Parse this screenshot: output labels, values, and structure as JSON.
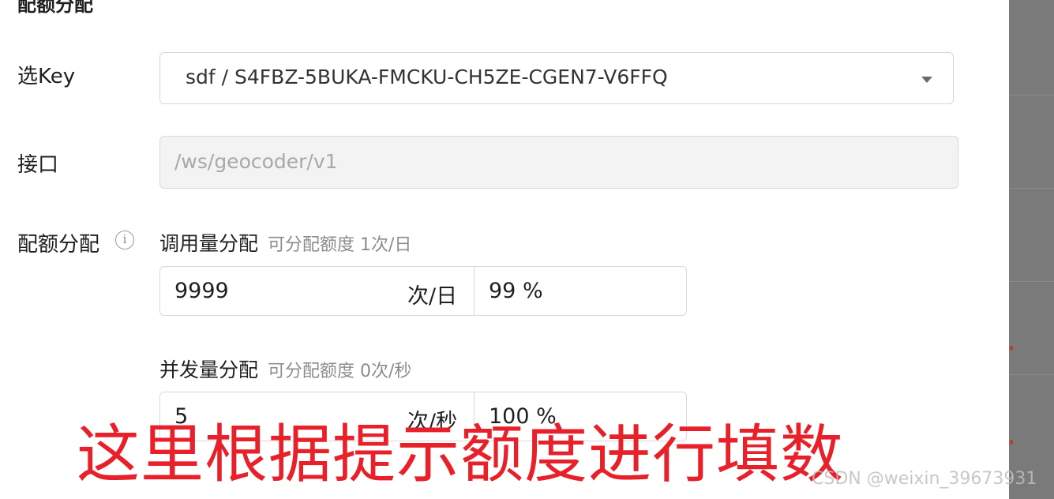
{
  "section": {
    "title": "配额分配"
  },
  "key_field": {
    "label": "选Key",
    "value": "sdf / S4FBZ-5BUKA-FMCKU-CH5ZE-CGEN7-V6FFQ"
  },
  "api_field": {
    "label": "接口",
    "placeholder": "/ws/geocoder/v1"
  },
  "quota": {
    "label": "配额分配",
    "info_icon": "info-circle-icon",
    "calls": {
      "title": "调用量分配",
      "hint": "可分配额度 1次/日",
      "value": "9999",
      "unit": "次/日",
      "percent": "99 %"
    },
    "concurrency": {
      "title": "并发量分配",
      "hint": "可分配额度 0次/秒",
      "value": "5",
      "unit": "次/秒",
      "percent": "100 %"
    }
  },
  "annotation": {
    "text": "这里根据提示额度进行填数",
    "color": "#e8202a"
  },
  "watermark": {
    "text": "CSDN @weixin_39673931"
  }
}
